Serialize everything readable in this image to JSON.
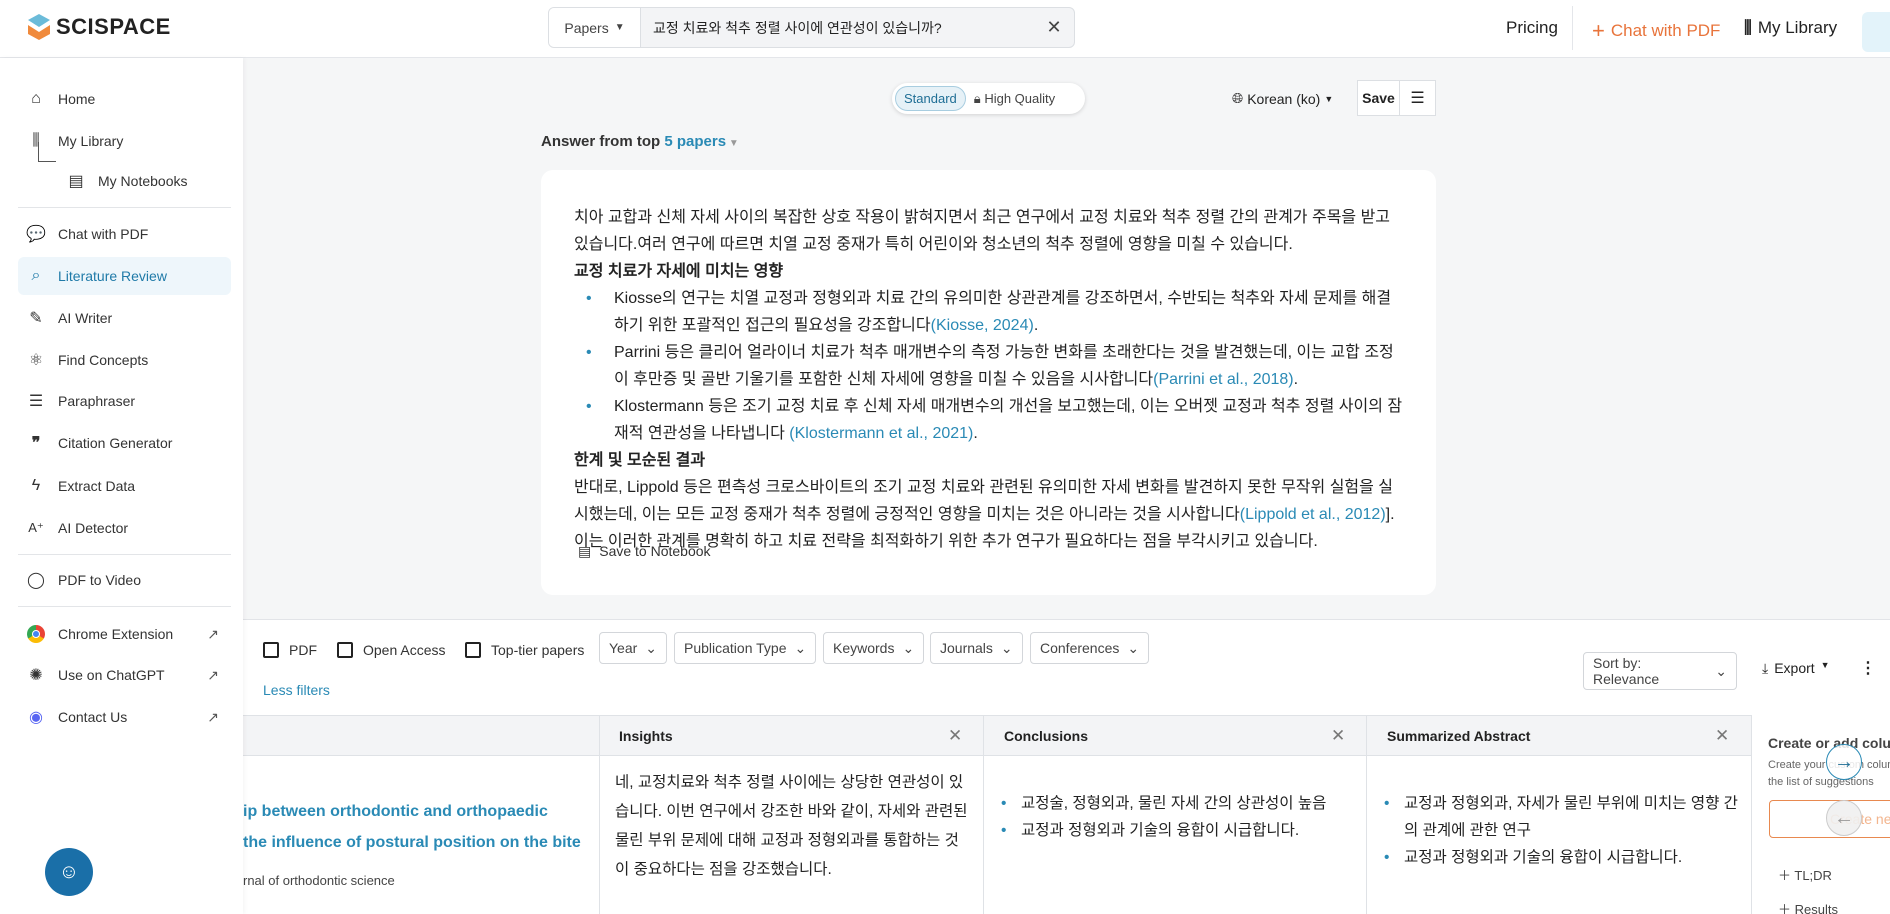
{
  "header": {
    "logo": "SCISPACE",
    "search_scope": "Papers",
    "search_query": "교정 치료와 척추 정렬 사이에 연관성이 있습니까?",
    "pricing": "Pricing",
    "chat_pdf": "Chat with PDF",
    "my_library": "My Library"
  },
  "sidebar": {
    "items": [
      {
        "label": "Home",
        "icon": "home-icon"
      },
      {
        "label": "My Library",
        "icon": "library-icon"
      },
      {
        "label": "My Notebooks",
        "icon": "notebook-icon"
      },
      {
        "label": "Chat with PDF",
        "icon": "chat-icon"
      },
      {
        "label": "Literature Review",
        "icon": "search-doc-icon"
      },
      {
        "label": "AI Writer",
        "icon": "pen-icon"
      },
      {
        "label": "Find Concepts",
        "icon": "concepts-icon"
      },
      {
        "label": "Paraphraser",
        "icon": "paraphrase-icon"
      },
      {
        "label": "Citation Generator",
        "icon": "quote-icon"
      },
      {
        "label": "Extract Data",
        "icon": "bolt-icon"
      },
      {
        "label": "AI Detector",
        "icon": "ai-detector-icon"
      },
      {
        "label": "PDF to Video",
        "icon": "user-icon"
      },
      {
        "label": "Chrome Extension",
        "icon": "chrome-icon"
      },
      {
        "label": "Use on ChatGPT",
        "icon": "openai-icon"
      },
      {
        "label": "Contact Us",
        "icon": "discord-icon"
      }
    ]
  },
  "toolbar": {
    "standard": "Standard",
    "high_quality": "High Quality",
    "language": "Korean (ko)",
    "save": "Save"
  },
  "answer": {
    "prefix": "Answer from top",
    "papers_link": "5 papers",
    "intro": "치아 교합과 신체 자세 사이의 복잡한 상호 작용이 밝혀지면서 최근 연구에서 교정 치료와 척추 정렬 간의 관계가 주목을 받고 있습니다.여러 연구에 따르면 치열 교정 중재가 특히 어린이와 청소년의 척추 정렬에 영향을 미칠 수 있습니다.",
    "h1": "교정 치료가 자세에 미치는 영향",
    "bullets": [
      {
        "text": "Kiosse의 연구는 치열 교정과 정형외과 치료 간의 유의미한 상관관계를 강조하면서, 수반되는 척추와 자세 문제를 해결하기 위한 포괄적인 접근의 필요성을 강조합니다",
        "cite": "(Kiosse, 2024)"
      },
      {
        "text": "Parrini 등은 클리어 얼라이너 치료가 척추 매개변수의 측정 가능한 변화를 초래한다는 것을 발견했는데, 이는 교합 조정이 후만증 및 골반 기울기를 포함한 신체 자세에 영향을 미칠 수 있음을 시사합니다",
        "cite": "(Parrini et al., 2018)"
      },
      {
        "text": "Klostermann 등은 조기 교정 치료 후 신체 자세 매개변수의 개선을 보고했는데, 이는 오버젯 교정과 척추 정렬 사이의 잠재적 연관성을 나타냅니다 ",
        "cite": "(Klostermann et al., 2021)"
      }
    ],
    "h2": "한계 및 모순된 결과",
    "p2a": "반대로, Lippold 등은 편측성 크로스바이트의 조기 교정 치료와 관련된 유의미한 자세 변화를 발견하지 못한 무작위 실험을 실시했는데, 이는 모든 교정 중재가 척추 정렬에 긍정적인 영향을 미치는 것은 아니라는 것을 시사합니다",
    "p2cite": "(Lippold et al., 2012)",
    "p2b": "].이는 이러한 관계를 명확히 하고 치료 전략을 최적화하기 위한 추가 연구가 필요하다는 점을 부각시키고 있습니다.",
    "save_notebook": "Save to Notebook"
  },
  "filters": {
    "checkboxes": [
      "PDF",
      "Open Access",
      "Top-tier papers"
    ],
    "dropdowns": [
      "Year",
      "Publication Type",
      "Keywords",
      "Journals",
      "Conferences"
    ],
    "less_filters": "Less filters",
    "sort": "Sort by: Relevance",
    "export": "Export"
  },
  "table": {
    "columns": [
      "Insights",
      "Conclusions",
      "Summarized Abstract"
    ],
    "row": {
      "title_line1": "ip between orthodontic and orthopaedic",
      "title_line2": "the influence of postural position on the bite",
      "journal": "rnal of orthodontic science",
      "insights": "네, 교정치료와 척추 정렬 사이에는 상당한 연관성이 있습니다. 이번 연구에서 강조한 바와 같이, 자세와 관련된 물린 부위 문제에 대해 교정과 정형외과를 통합하는 것이 중요하다는 점을 강조했습니다.",
      "conclusions": [
        "교정술, 정형외과, 물린 자세 간의 상관성이 높음",
        "교정과 정형외과 기술의 융합이 시급합니다."
      ],
      "abstract": [
        "교정과 정형외과, 자세가 물린 부위에 미치는 영향 간의 관계에 관한 연구",
        "교정과 정형외과 기술의 융합이 시급합니다."
      ]
    }
  },
  "right_panel": {
    "title": "Create or add columns",
    "desc1": "Create your custom columns or pick from",
    "desc2": "the list of suggestions",
    "create_btn": "Create new",
    "suggestions": [
      "TL;DR",
      "Results"
    ]
  }
}
